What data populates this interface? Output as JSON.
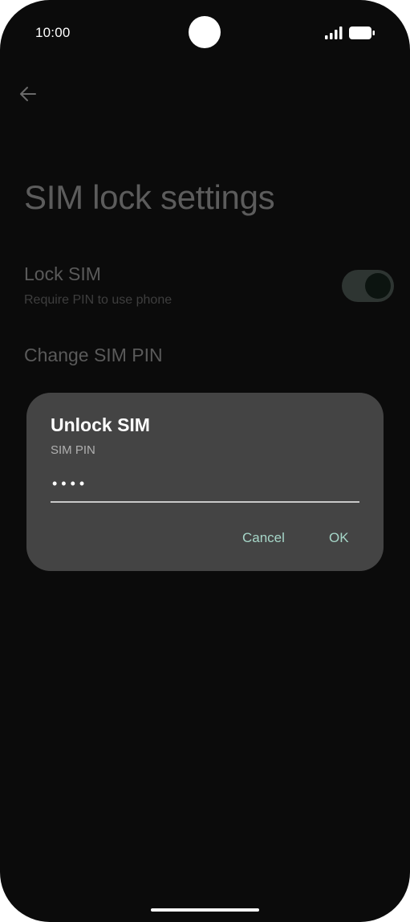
{
  "status_bar": {
    "time": "10:00",
    "icons": [
      "camera-cutout-icon",
      "signal-icon",
      "battery-icon"
    ]
  },
  "header": {
    "back_icon": "back-arrow-icon",
    "title": "SIM lock settings"
  },
  "settings": {
    "lock_sim": {
      "title": "Lock SIM",
      "subtitle": "Require PIN to use phone",
      "toggle_on": true
    },
    "change_pin": {
      "title": "Change SIM PIN"
    }
  },
  "dialog": {
    "title": "Unlock SIM",
    "label": "SIM PIN",
    "pin_value": "••••",
    "cancel_label": "Cancel",
    "ok_label": "OK"
  },
  "colors": {
    "background": "#0b0b0b",
    "dialog_background": "#444444",
    "accent": "#a6d6c8",
    "title_dim": "#5c5c5c"
  }
}
